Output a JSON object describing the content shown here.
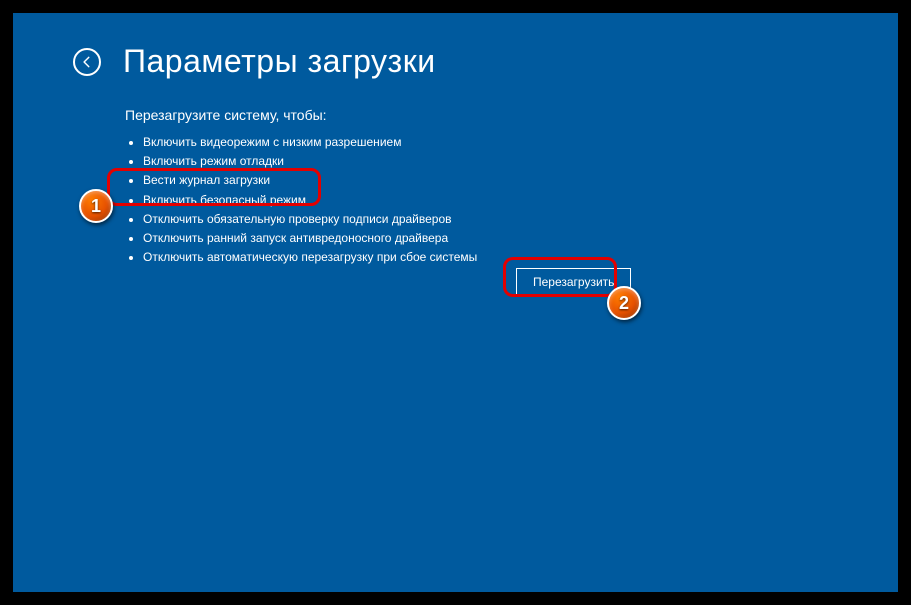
{
  "header": {
    "title": "Параметры загрузки"
  },
  "subtitle": "Перезагрузите систему, чтобы:",
  "options": [
    "Включить видеорежим с низким разрешением",
    "Включить режим отладки",
    "Вести журнал загрузки",
    "Включить безопасный режим",
    "Отключить обязательную проверку подписи драйверов",
    "Отключить ранний запуск антивредоносного драйвера",
    "Отключить автоматическую перезагрузку при сбое системы"
  ],
  "button": {
    "restart": "Перезагрузить"
  },
  "annotations": {
    "badge1": "1",
    "badge2": "2"
  }
}
